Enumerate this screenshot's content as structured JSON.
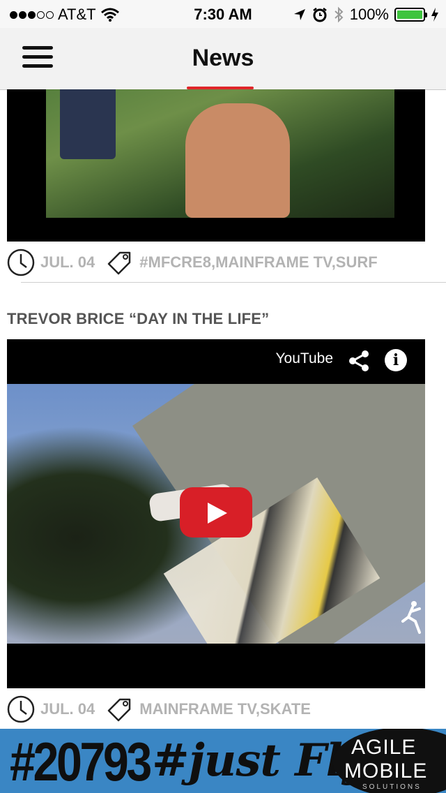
{
  "status_bar": {
    "carrier": "AT&T",
    "time": "7:30 AM",
    "battery": "100%",
    "signal_bars_filled": 3,
    "signal_bars_total": 5
  },
  "nav": {
    "title": "News"
  },
  "posts": [
    {
      "date": "JUL. 04",
      "tags": "#MFCRE8,MAINFRAME TV,SURF"
    },
    {
      "title": "TREVOR BRICE “DAY IN THE LIFE”",
      "video_brand": "YouTube",
      "date": "JUL. 04",
      "tags": "MAINFRAME TV,SKATE"
    }
  ],
  "ad": {
    "zip": "#20793",
    "slogan": "#just Fly",
    "logo_line1": "AGILE",
    "logo_line2": "MOBILE",
    "logo_line3": "SOLUTIONS"
  },
  "colors": {
    "accent": "#e0262a",
    "meta_text": "#b3b3b3",
    "ad_background": "#3a86c4",
    "battery": "#3ec43e"
  }
}
